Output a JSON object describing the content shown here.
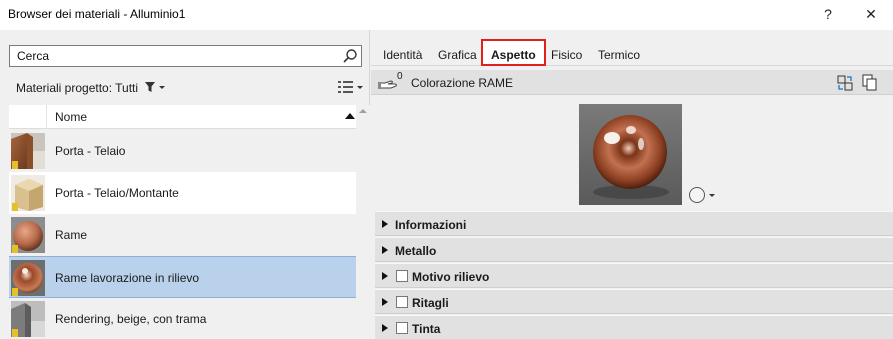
{
  "window": {
    "title": "Browser dei materiali - Alluminio1",
    "help_label": "?",
    "close_label": "✕"
  },
  "left": {
    "search": {
      "value": "Cerca",
      "placeholder": "Cerca"
    },
    "filter_label": "Materiali progetto: Tutti",
    "table": {
      "column_name": "Nome",
      "rows": [
        {
          "label": "Porta - Telaio",
          "swatch": "wood-brown"
        },
        {
          "label": "Porta - Telaio/Montante",
          "swatch": "beige-cube"
        },
        {
          "label": "Rame",
          "swatch": "copper-sphere"
        },
        {
          "label": "Rame lavorazione in rilievo",
          "swatch": "copper-polished"
        },
        {
          "label": "Rendering, beige, con trama",
          "swatch": "gray-texture"
        }
      ]
    }
  },
  "right": {
    "tabs": [
      {
        "label": "Identità"
      },
      {
        "label": "Grafica"
      },
      {
        "label": "Aspetto"
      },
      {
        "label": "Fisico"
      },
      {
        "label": "Termico"
      }
    ],
    "active_tab": "Aspetto",
    "asset": {
      "count": "0",
      "name": "Colorazione RAME"
    },
    "properties": [
      {
        "label": "Informazioni",
        "checkbox": false
      },
      {
        "label": "Metallo",
        "checkbox": false
      },
      {
        "label": "Motivo rilievo",
        "checkbox": true
      },
      {
        "label": "Ritagli",
        "checkbox": true
      },
      {
        "label": "Tinta",
        "checkbox": true
      }
    ]
  },
  "colors": {
    "selected_row": "#b9d1ea",
    "active_tab_border": "#e0201f",
    "copper": "#b5694a"
  }
}
